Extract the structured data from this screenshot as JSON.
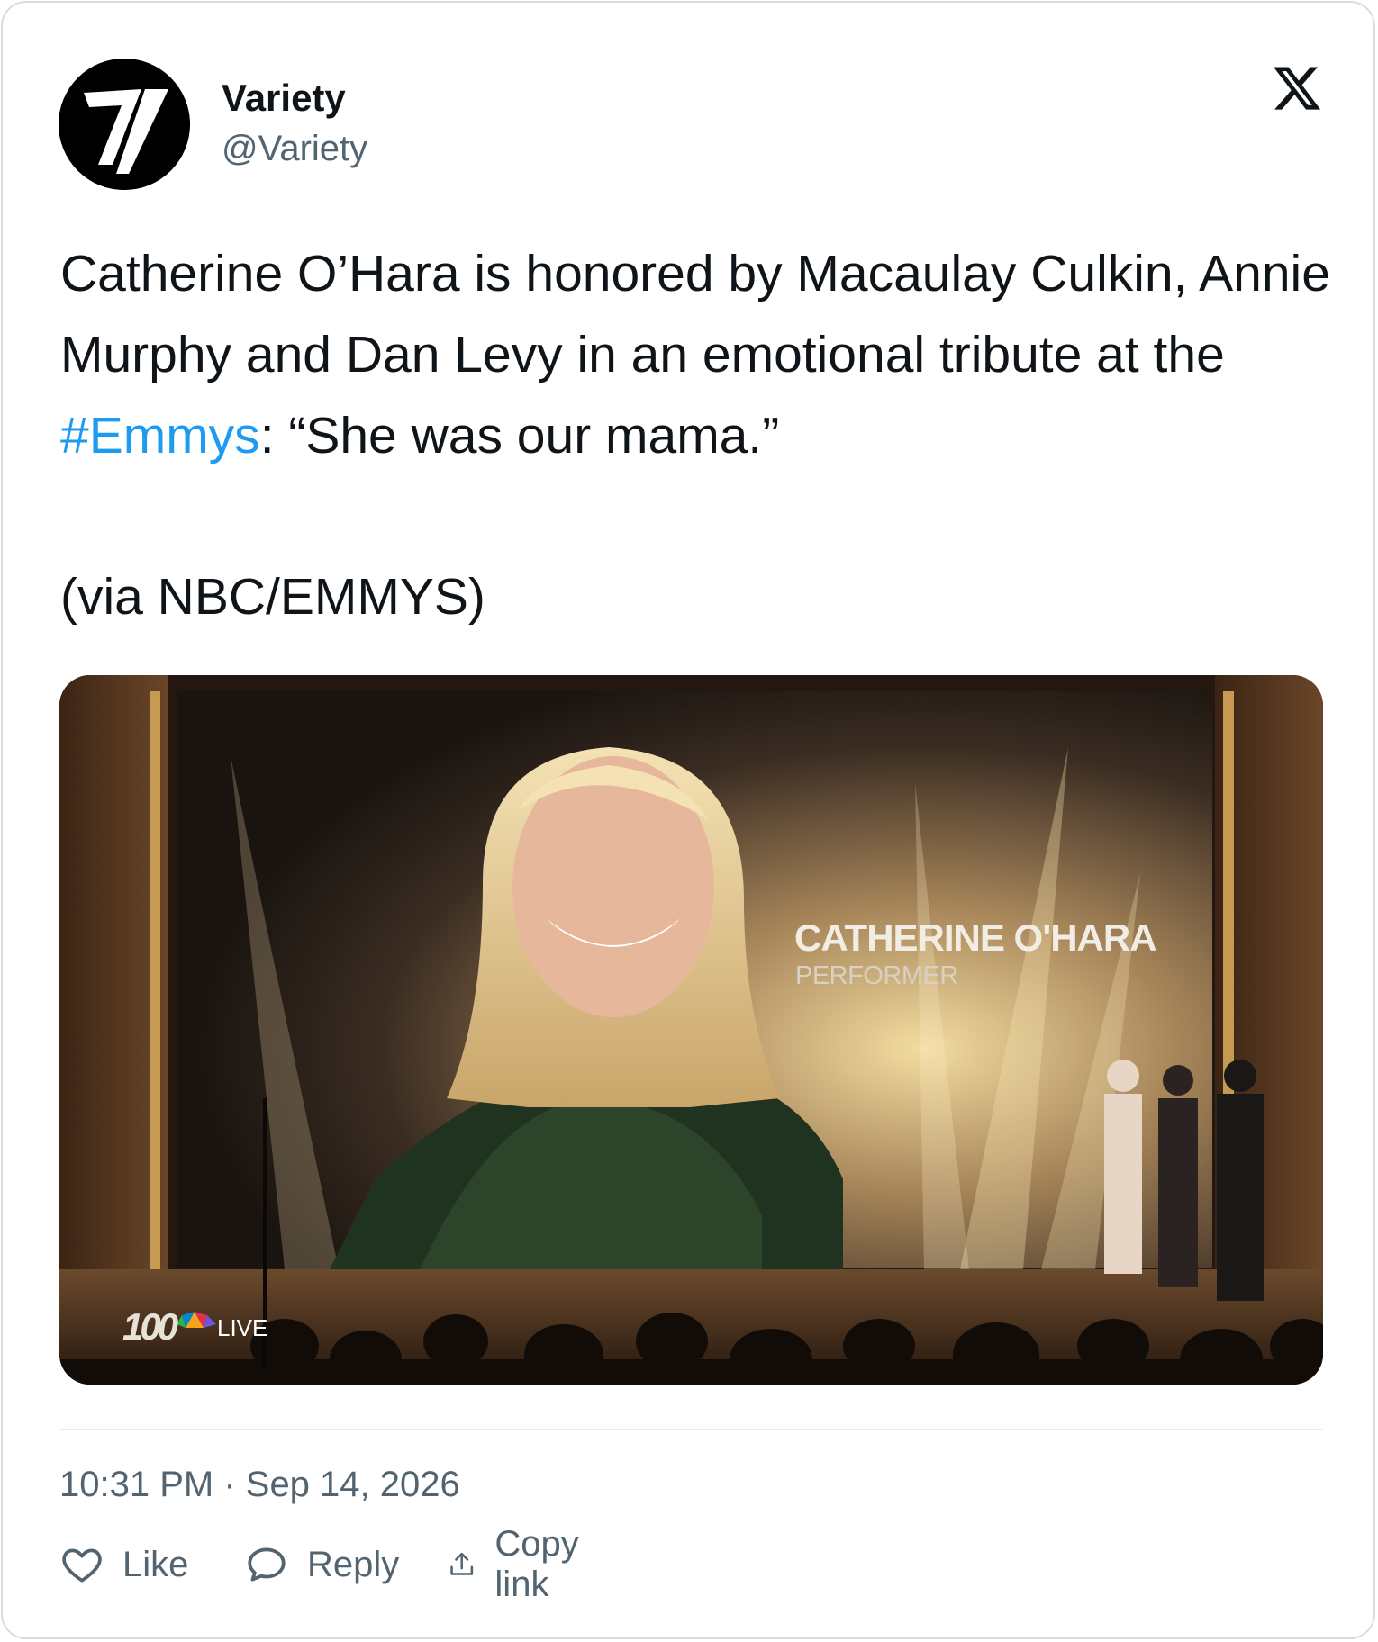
{
  "author": {
    "display_name": "Variety",
    "handle": "@Variety",
    "avatar_icon": "variety-v-logo-icon"
  },
  "platform_icon": "x-logo-icon",
  "tweet": {
    "text_before": "Catherine O’Hara is honored by Macaulay Culkin, Annie Murphy and Dan Levy in an emotional tribute at the ",
    "hashtag": "#Emmys",
    "text_after": ": “She was our mama.”",
    "source": "(via NBC/EMMYS)"
  },
  "media": {
    "screen_name": "CATHERINE O'HARA",
    "screen_role": "PERFORMER",
    "bug_number": "100",
    "bug_live": "LIVE"
  },
  "timestamp": "10:31 PM · Sep 14, 2026",
  "actions": {
    "like": "Like",
    "reply": "Reply",
    "copy_link": "Copy link"
  },
  "colors": {
    "hashtag": "#1d9bf0",
    "secondary_text": "#536471",
    "border": "#d5dde3"
  }
}
